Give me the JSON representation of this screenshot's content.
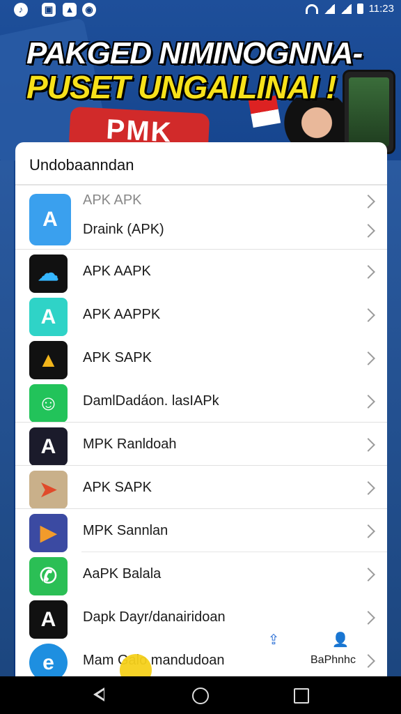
{
  "status_bar": {
    "time": "11:23",
    "left_icons": [
      "tiktok-icon",
      "screenshot-icon",
      "photo-icon",
      "camera-icon"
    ]
  },
  "banner": {
    "headline_line1": "PAKGED NIMINOGNNA-",
    "headline_line2": "PUSET UNGAILINAI !",
    "badge_text": "PMK"
  },
  "sheet": {
    "title": "Undobaanndan",
    "items": [
      {
        "label_top": "APK APK",
        "label": "Draink (APK)",
        "icon": "app-store-a-icon",
        "icon_bg": "#3aa0ee",
        "icon_color": "#ffffff",
        "glyph": "A"
      },
      {
        "label": "APK AAPK",
        "icon": "cloud-link-icon",
        "icon_bg": "#111111",
        "icon_color": "#35b6ff",
        "glyph": "☁"
      },
      {
        "label": "APK AAPPK",
        "icon": "green-a-icon",
        "icon_bg": "#2fd3c7",
        "icon_color": "#ffffff",
        "glyph": "A"
      },
      {
        "label": "APK SAPK",
        "icon": "gold-logo-icon",
        "icon_bg": "#111111",
        "icon_color": "#f2b51b",
        "glyph": "▲"
      },
      {
        "label": "DamlDadáon. lasIAPk",
        "icon": "chat-bubble-icon",
        "icon_bg": "#22c35a",
        "icon_color": "#ffffff",
        "glyph": "☺"
      },
      {
        "label": "MPK Ranldoah",
        "icon": "black-a-icon",
        "icon_bg": "#1b1b2b",
        "icon_color": "#ffffff",
        "glyph": "A"
      },
      {
        "label": "APK SAPK",
        "icon": "paper-plane-icon",
        "icon_bg": "#c9b08a",
        "icon_color": "#e04a2a",
        "glyph": "➤"
      },
      {
        "label": "MPK Sannlan",
        "icon": "prism-icon",
        "icon_bg": "#3b4aa2",
        "icon_color": "#f29b2b",
        "glyph": "▶"
      },
      {
        "label": "AaPK Balala",
        "icon": "whatsapp-icon",
        "icon_bg": "#2bbf55",
        "icon_color": "#ffffff",
        "glyph": "✆"
      },
      {
        "label": "Dapk Dayr/danairidoan",
        "icon": "red-a-logo-icon",
        "icon_bg": "#111111",
        "icon_color": "#ffffff",
        "glyph": "A"
      },
      {
        "label": "Mam Galo mandudoan",
        "icon": "blue-round-icon",
        "icon_bg": "#1e8fe0",
        "icon_color": "#ffffff",
        "glyph": "e",
        "trailing": "BaPhnhc"
      }
    ]
  },
  "floating": {
    "left_icon": "share-icon",
    "right_icon": "user-add-icon"
  },
  "nav_bar": {
    "back": "back-icon",
    "home": "home-icon",
    "recent": "recent-apps-icon"
  }
}
